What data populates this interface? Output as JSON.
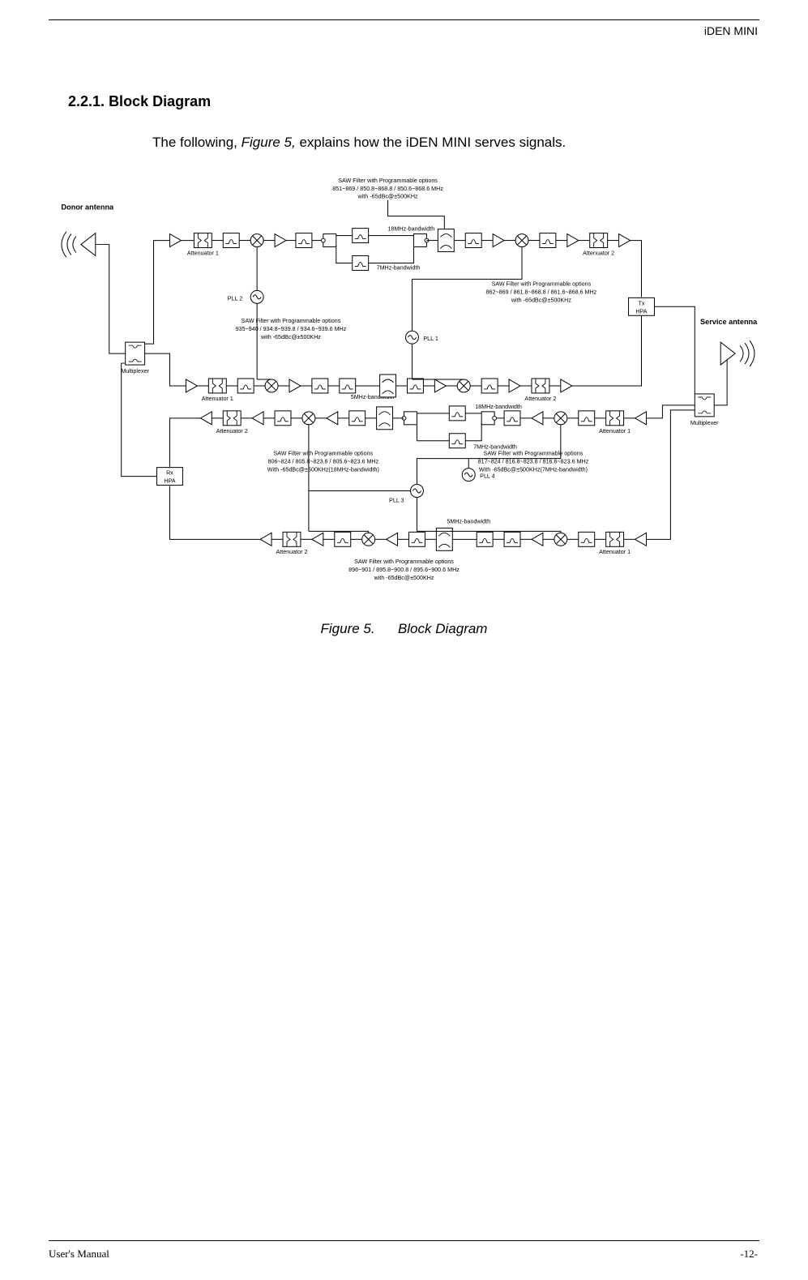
{
  "header": {
    "title": "iDEN MINI"
  },
  "section": {
    "number": "2.2.1.",
    "title": "Block Diagram",
    "intro_prefix": "The following, ",
    "intro_italic": "Figure 5,",
    "intro_suffix": " explains how the iDEN MINI serves signals."
  },
  "figure": {
    "caption_num": "Figure 5.",
    "caption_title": "Block Diagram",
    "labels": {
      "donor_antenna": "Donor antenna",
      "service_antenna": "Service antenna",
      "multiplexer": "Multiplexer",
      "attenuator1": "Attenuator 1",
      "attenuator2": "Attenuator 2",
      "tx_hpa": "Tx HPA",
      "rx_hpa": "Rx HPA",
      "pll1": "PLL 1",
      "pll2": "PLL 2",
      "pll3": "PLL 3",
      "pll4": "PLL 4",
      "bw18": "18MHz-bandwidth",
      "bw7": "7MHz-bandwidth",
      "bw5": "5MHz-bandwidth",
      "saw1_l1": "SAW Filter with Programmable options",
      "saw1_l2": "851~869 / 850.8~868.8 / 850.6~868.6 MHz",
      "saw1_l3": "with -65dBc@±500KHz",
      "saw2_l1": "SAW Filter with Programmable options",
      "saw2_l2": "862~869 / 861.8~868.8 / 861.6~868.6 MHz",
      "saw2_l3": "with -65dBc@±500KHz",
      "saw3_l1": "SAW Filter with Programmable options",
      "saw3_l2": "935~940 / 934.8~939.8 / 934.6~939.6 MHz",
      "saw3_l3": "with -65dBc@±500KHz",
      "saw4_l1": "SAW Filter with Programmable options",
      "saw4_l2": "806~824 / 805.8~823.8 / 805.6~823.6 MHz",
      "saw4_l3": "With -65dBc@±500KHz(18MHz-bandwidth)",
      "saw5_l1": "SAW Filter with Programmable options",
      "saw5_l2": "817~824 / 816.8~823.8 / 816.6~823.6 MHz",
      "saw5_l3": "With -65dBc@±500KHz(7MHz-bandwidth)",
      "saw6_l1": "SAW Filter with Programmable options",
      "saw6_l2": "896~901 / 895.8~900.8 / 895.6~900.6 MHz",
      "saw6_l3": "with -65dBc@±500KHz"
    }
  },
  "footer": {
    "left": "User's Manual",
    "right": "-12-"
  }
}
